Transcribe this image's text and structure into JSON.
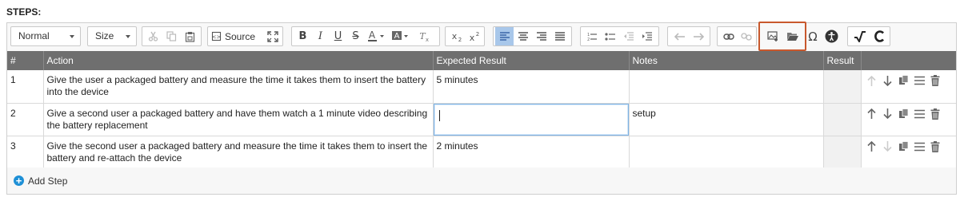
{
  "section_label": "STEPS:",
  "toolbar": {
    "format_value": "Normal",
    "size_value": "Size",
    "source_label": "Source"
  },
  "table": {
    "headers": [
      "#",
      "Action",
      "Expected Result",
      "Notes",
      "Result",
      ""
    ],
    "rows": [
      {
        "num": "1",
        "action": "Give the user a packaged battery and measure the time it takes them to insert the battery into the device",
        "expected": "5 minutes",
        "notes": "",
        "result": ""
      },
      {
        "num": "2",
        "action": "Give a second user a packaged battery and have them watch a 1 minute video describing the battery replacement",
        "expected": "",
        "notes": "setup",
        "result": ""
      },
      {
        "num": "3",
        "action": "Give the second user a packaged battery and measure the time it takes them to insert the battery and re-attach the device",
        "expected": "2 minutes",
        "notes": "",
        "result": ""
      }
    ]
  },
  "add_step_label": "Add Step",
  "colors": {
    "header_bg": "#6f6f6f",
    "accent": "#1e90d6",
    "highlight": "#c8582d"
  }
}
